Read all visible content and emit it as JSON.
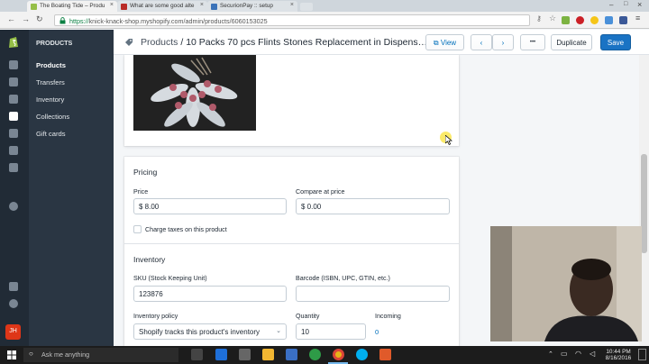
{
  "browser": {
    "tabs": [
      {
        "label": "The Boating Tide – Produ",
        "active": true,
        "favicon_color": "#96bf48"
      },
      {
        "label": "What are some good alte",
        "active": false,
        "favicon_color": "#b92b27"
      },
      {
        "label": "SecurionPay :: setup",
        "active": false,
        "favicon_color": "#3b73b9"
      }
    ],
    "url_secure": "https://",
    "url_rest": "knick-knack-shop.myshopify.com/admin/products/6060153025"
  },
  "sidebar": {
    "avatar_initials": "JH",
    "section_title": "PRODUCTS",
    "items": [
      {
        "label": "Products",
        "active": true
      },
      {
        "label": "Transfers",
        "active": false
      },
      {
        "label": "Inventory",
        "active": false
      },
      {
        "label": "Collections",
        "active": false
      },
      {
        "label": "Gift cards",
        "active": false
      }
    ]
  },
  "topbar": {
    "breadcrumb_parent": "Products",
    "separator": "/",
    "product_title": "10 Packs 70 pcs Flints Stones Replacement in Dispens…",
    "view_label": "View",
    "more_label": "•••",
    "duplicate_label": "Duplicate",
    "save_label": "Save"
  },
  "pricing": {
    "heading": "Pricing",
    "price_label": "Price",
    "price_value": "$ 8.00",
    "compare_label": "Compare at price",
    "compare_value": "$ 0.00",
    "charge_taxes_label": "Charge taxes on this product",
    "charge_taxes_checked": false
  },
  "inventory": {
    "heading": "Inventory",
    "sku_label": "SKU (Stock Keeping Unit)",
    "sku_value": "123876",
    "barcode_label": "Barcode (ISBN, UPC, GTIN, etc.)",
    "barcode_value": "",
    "policy_label": "Inventory policy",
    "policy_value": "Shopify tracks this product's inventory",
    "quantity_label": "Quantity",
    "quantity_value": "10",
    "incoming_label": "Incoming",
    "incoming_value": "0"
  },
  "taskbar": {
    "search_placeholder": "Ask me anything",
    "time": "10:44 PM",
    "date": "8/16/2016"
  },
  "colors": {
    "sidebar_dark": "#212b36",
    "subnav": "#2a3643",
    "primary_button": "#1a73c4",
    "link_blue": "#006fbb"
  }
}
